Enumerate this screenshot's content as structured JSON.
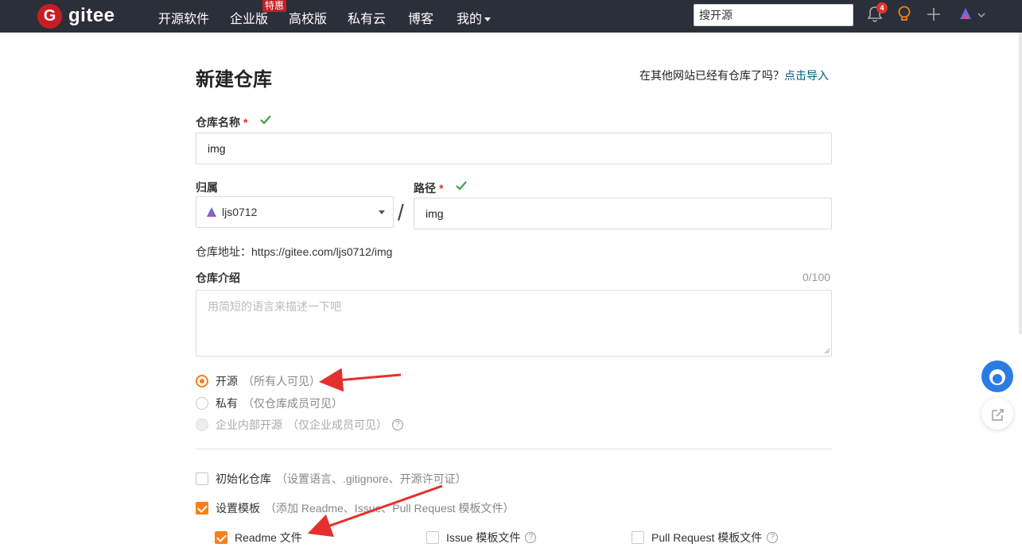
{
  "header": {
    "logo_text": "gitee",
    "nav": [
      {
        "label": "开源软件"
      },
      {
        "label": "企业版",
        "badge": "特惠"
      },
      {
        "label": "高校版"
      },
      {
        "label": "私有云"
      },
      {
        "label": "博客"
      },
      {
        "label": "我的"
      }
    ],
    "search_placeholder": "搜开源",
    "notification_count": "4"
  },
  "main": {
    "title": "新建仓库",
    "import_tip": "在其他网站已经有仓库了吗？",
    "import_link": "点击导入",
    "repo_name_label": "仓库名称",
    "repo_name_value": "img",
    "owner_label": "归属",
    "owner_value": "ljs0712",
    "path_label": "路径",
    "path_value": "img",
    "required_mark": "*",
    "slash": "/",
    "repo_url": "仓库地址：https://gitee.com/ljs0712/img",
    "desc_label": "仓库介绍",
    "desc_counter": "0/100",
    "desc_placeholder": "用简短的语言来描述一下吧",
    "visibility": [
      {
        "label": "开源",
        "hint": "（所有人可见）",
        "selected": true
      },
      {
        "label": "私有",
        "hint": "（仅仓库成员可见）",
        "selected": false
      },
      {
        "label": "企业内部开源",
        "hint": "（仅企业成员可见）",
        "selected": false,
        "disabled": true
      }
    ],
    "init_repo": {
      "label": "初始化仓库",
      "hint": "（设置语言、.gitignore、开源许可证）",
      "checked": false
    },
    "set_template": {
      "label": "设置模板",
      "hint": "（添加 Readme、Issue、Pull Request 模板文件）",
      "checked": true
    },
    "templates": [
      {
        "label": "Readme 文件",
        "checked": true
      },
      {
        "label": "Issue 模板文件",
        "checked": false
      },
      {
        "label": "Pull Request 模板文件",
        "checked": false
      }
    ]
  },
  "colors": {
    "brand": "#c71d23",
    "accent": "#f7801b",
    "link": "#005980",
    "success": "#3fa33f",
    "annotation_arrow": "#e2312d"
  }
}
